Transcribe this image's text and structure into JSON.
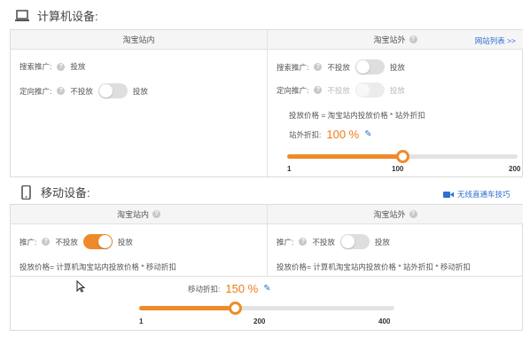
{
  "computer": {
    "title": "计算机设备:",
    "inside_header": "淘宝站内",
    "outside_header": "淘宝站外",
    "site_list_link": "网站列表 >>",
    "inside": {
      "search_label": "搜索推广:",
      "search_value": "投放",
      "target_label": "定向推广:",
      "target_off": "不投放",
      "target_on": "投放"
    },
    "outside": {
      "search_label": "搜索推广:",
      "search_off": "不投放",
      "search_on": "投放",
      "target_label": "定向推广:",
      "target_off": "不投放",
      "target_on": "投放",
      "formula": "投放价格 = 淘宝站内投放价格 * 站外折扣",
      "discount_label": "站外折扣:",
      "discount_value": "100 %",
      "slider_min": "1",
      "slider_mid": "100",
      "slider_max": "200",
      "slider_value_fraction": 0.5
    }
  },
  "mobile": {
    "title": "移动设备:",
    "wireless_link": "无线直通车技巧",
    "inside_header": "淘宝站内",
    "outside_header": "淘宝站外",
    "inside": {
      "promo_label": "推广:",
      "promo_off": "不投放",
      "promo_on": "投放",
      "formula": "投放价格= 计算机淘宝站内投放价格 * 移动折扣"
    },
    "outside": {
      "promo_label": "推广:",
      "promo_off": "不投放",
      "promo_on": "投放",
      "formula": "投放价格= 计算机淘宝站内投放价格 * 站外折扣 * 移动折扣"
    },
    "discount_label": "移动折扣:",
    "discount_value": "150 %",
    "slider_min": "1",
    "slider_mid": "200",
    "slider_max": "400",
    "slider_value_fraction": 0.375
  },
  "colors": {
    "accent": "#ef8a2a",
    "link": "#2f6fd0"
  }
}
